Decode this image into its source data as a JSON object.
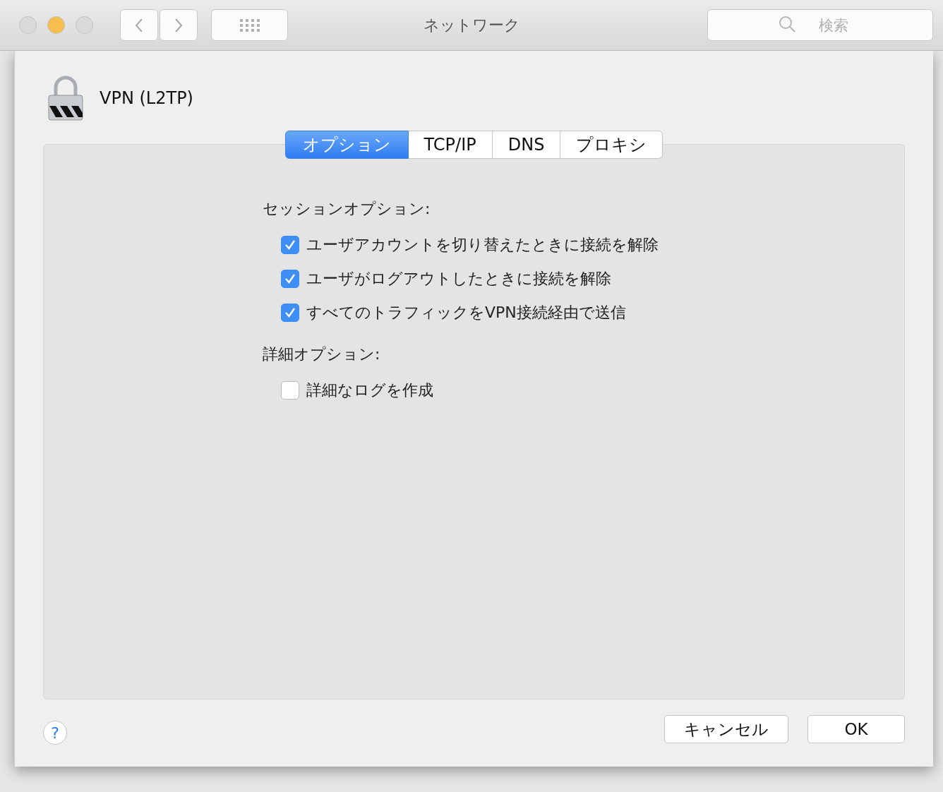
{
  "window": {
    "title": "ネットワーク",
    "traffic_lights": [
      {
        "color": "#d9d9d9"
      },
      {
        "color": "#f5be4f"
      },
      {
        "color": "#d9d9d9"
      }
    ]
  },
  "search": {
    "placeholder": "検索"
  },
  "sheet": {
    "title": "VPN (L2TP)",
    "tabs": [
      {
        "label": "オプション",
        "selected": true
      },
      {
        "label": "TCP/IP",
        "selected": false
      },
      {
        "label": "DNS",
        "selected": false
      },
      {
        "label": "プロキシ",
        "selected": false
      }
    ],
    "sections": [
      {
        "heading": "セッションオプション:",
        "options": [
          {
            "label": "ユーザアカウントを切り替えたときに接続を解除",
            "checked": true
          },
          {
            "label": "ユーザがログアウトしたときに接続を解除",
            "checked": true
          },
          {
            "label": "すべてのトラフィックをVPN接続経由で送信",
            "checked": true
          }
        ]
      },
      {
        "heading": "詳細オプション:",
        "options": [
          {
            "label": "詳細なログを作成",
            "checked": false
          }
        ]
      }
    ],
    "help": "?",
    "buttons": [
      "キャンセル",
      "OK"
    ]
  }
}
